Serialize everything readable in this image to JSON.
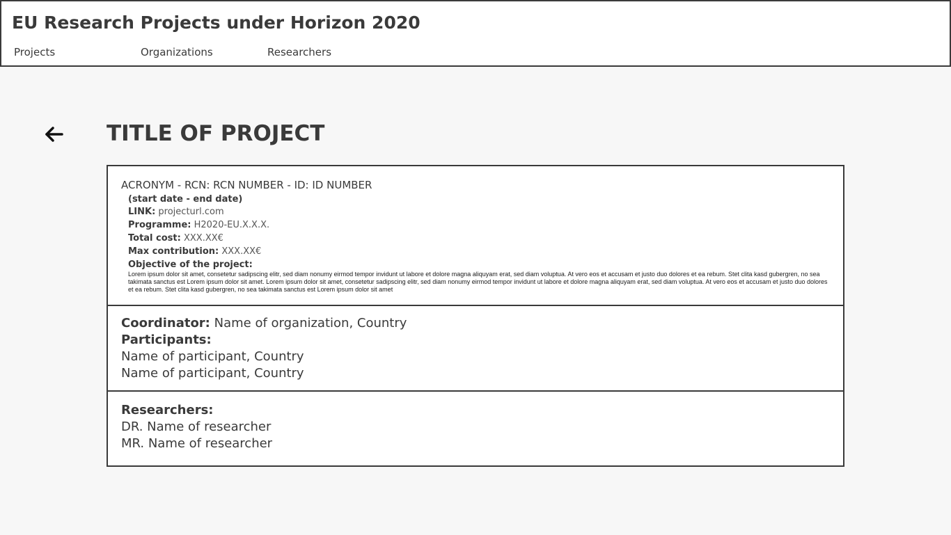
{
  "app": {
    "title": "EU Research Projects under Horizon 2020"
  },
  "nav": {
    "items": [
      {
        "label": "Projects"
      },
      {
        "label": "Organizations"
      },
      {
        "label": "Researchers"
      }
    ]
  },
  "page": {
    "back_icon": "arrow-left-icon",
    "title": "TITLE OF PROJECT"
  },
  "project": {
    "acronym_line": "ACRONYM - RCN: RCN NUMBER - ID: ID NUMBER",
    "dates": "(start date - end date)",
    "link_label": "LINK:",
    "link_value": "projecturl.com",
    "programme_label": "Programme:",
    "programme_value": "H2020-EU.X.X.X.",
    "total_cost_label": "Total cost:",
    "total_cost_value": "XXX.XX€",
    "max_contribution_label": "Max contribution:",
    "max_contribution_value": "XXX.XX€",
    "objective_label": "Objective of the project:",
    "objective_text": "Lorem ipsum dolor sit amet, consetetur sadipscing elitr, sed diam nonumy eirmod tempor invidunt ut labore et dolore magna aliquyam erat, sed diam voluptua. At vero eos et accusam et justo duo dolores et ea rebum. Stet clita kasd gubergren, no sea takimata sanctus est Lorem ipsum dolor sit amet. Lorem ipsum dolor sit amet, consetetur sadipscing elitr, sed diam nonumy eirmod tempor invidunt ut labore et dolore magna aliquyam erat, sed diam voluptua. At vero eos et accusam et justo duo dolores et ea rebum. Stet clita kasd gubergren, no sea takimata sanctus est Lorem ipsum dolor sit amet"
  },
  "organizations": {
    "coordinator_label": "Coordinator:",
    "coordinator_value": "Name of organization, Country",
    "participants_label": "Participants:",
    "participants": [
      "Name of participant, Country",
      "Name of participant, Country"
    ]
  },
  "researchers": {
    "label": "Researchers:",
    "items": [
      "DR. Name of researcher",
      "MR. Name of researcher"
    ]
  }
}
